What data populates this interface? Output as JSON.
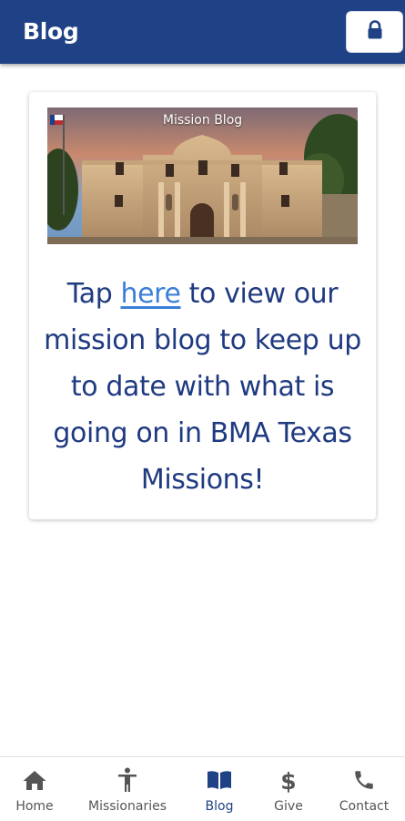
{
  "header": {
    "title": "Blog",
    "lock_icon": "lock-icon"
  },
  "card": {
    "banner_caption": "Mission Blog",
    "banner_image": "alamo-mission-photo",
    "text_before_link": "Tap ",
    "link_text": "here",
    "text_after_link": " to view our mission blog to keep up to date with what is going on in BMA Texas Missions!"
  },
  "bottom_nav": {
    "items": [
      {
        "label": "Home",
        "icon": "home-icon",
        "active": false
      },
      {
        "label": "Missionaries",
        "icon": "person-icon",
        "active": false
      },
      {
        "label": "Blog",
        "icon": "book-icon",
        "active": true
      },
      {
        "label": "Give",
        "icon": "dollar-icon",
        "active": false
      },
      {
        "label": "Contact",
        "icon": "phone-icon",
        "active": false
      }
    ]
  },
  "colors": {
    "header_bg": "#1f4185",
    "text_primary": "#1f3a80",
    "link": "#3a7fd8",
    "nav_inactive": "#555555",
    "nav_active": "#1f4185"
  }
}
